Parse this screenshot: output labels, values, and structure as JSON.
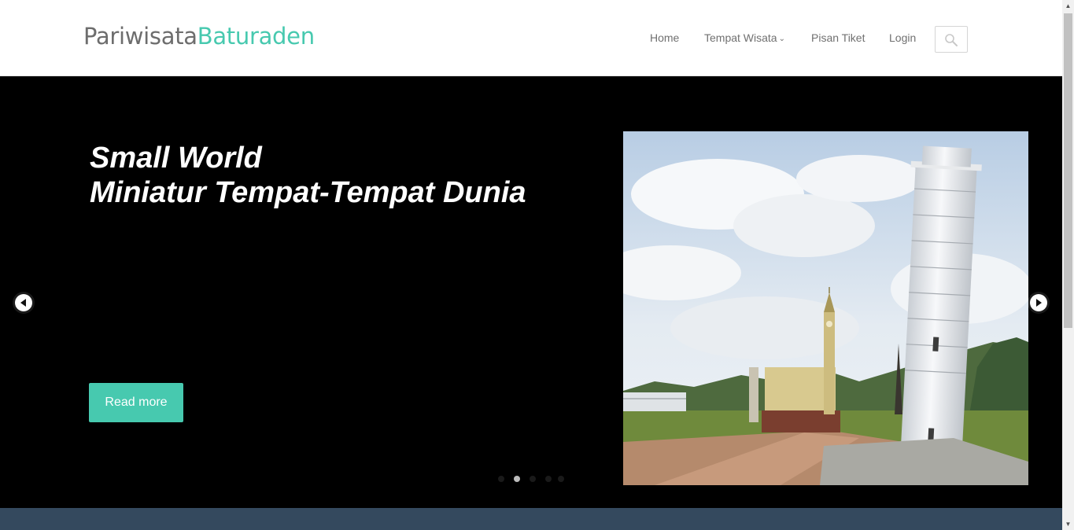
{
  "brand": {
    "part1": "Pariwisata",
    "part2": "Baturaden"
  },
  "nav": {
    "home": "Home",
    "tempat_wisata": "Tempat Wisata",
    "pisan_tiket": "Pisan Tiket",
    "login": "Login"
  },
  "hero": {
    "title_line1": "Small World",
    "title_line2": "Miniatur Tempat-Tempat Dunia",
    "button": "Read more",
    "image_alt": "Leaning Tower of Pisa and Big Ben miniatures",
    "slides": 5,
    "active_slide": 2
  },
  "colors": {
    "accent": "#47c9af",
    "hero_bg": "#000000",
    "footer_band": "#34495e",
    "brand_grey": "#6d6d6d",
    "nav_text": "#707070"
  },
  "icons": {
    "search": "search-icon",
    "prev": "arrow-left-circle-icon",
    "next": "arrow-right-circle-icon",
    "dropdown": "chevron-down-icon"
  }
}
